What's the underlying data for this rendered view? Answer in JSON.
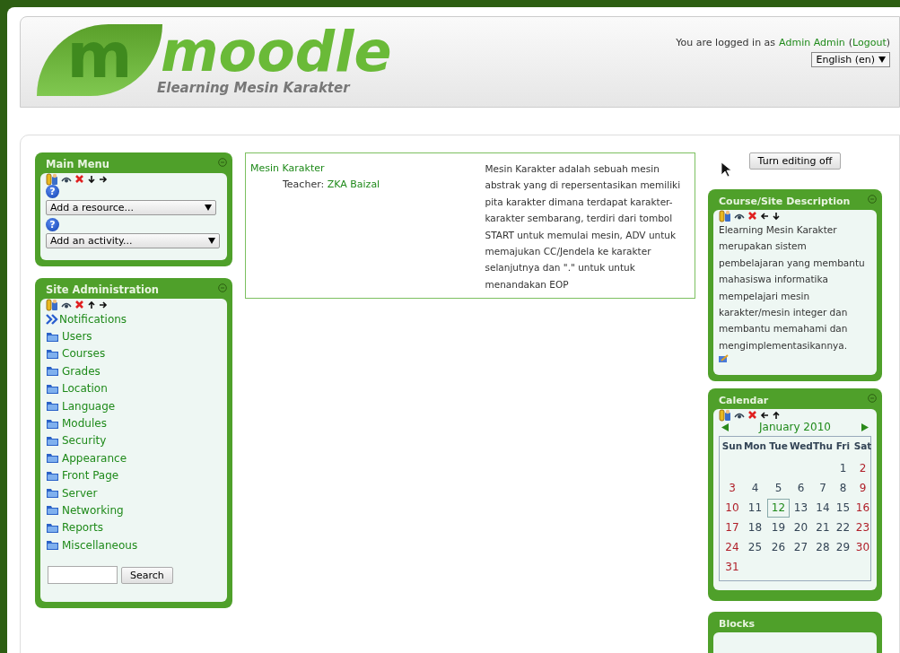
{
  "header": {
    "logo_letter": "m",
    "logo_word": "moodle",
    "site_name": "Elearning Mesin Karakter",
    "login_prefix": "You are logged in as",
    "user": "Admin Admin",
    "paren_open": "(",
    "logout": "Logout",
    "paren_close": ")",
    "language": "English (en)"
  },
  "left_blocks": [
    {
      "kind": "menu",
      "title": "Main Menu",
      "help": "?",
      "selects": [
        "Add a resource...",
        "Add an activity..."
      ]
    },
    {
      "kind": "admin",
      "title": "Site Administration",
      "items": [
        {
          "kind": "link",
          "label": "Notifications"
        },
        {
          "kind": "folder",
          "label": "Users"
        },
        {
          "kind": "folder",
          "label": "Courses"
        },
        {
          "kind": "folder",
          "label": "Grades"
        },
        {
          "kind": "folder",
          "label": "Location"
        },
        {
          "kind": "folder",
          "label": "Language"
        },
        {
          "kind": "folder",
          "label": "Modules"
        },
        {
          "kind": "folder",
          "label": "Security"
        },
        {
          "kind": "folder",
          "label": "Appearance"
        },
        {
          "kind": "folder",
          "label": "Front Page"
        },
        {
          "kind": "folder",
          "label": "Server"
        },
        {
          "kind": "folder",
          "label": "Networking"
        },
        {
          "kind": "folder",
          "label": "Reports"
        },
        {
          "kind": "folder",
          "label": "Miscellaneous"
        }
      ],
      "search_button": "Search"
    }
  ],
  "course": {
    "name": "Mesin Karakter",
    "teacher_label": "Teacher:",
    "teacher": "ZKA Baizal",
    "summary": "Mesin Karakter adalah sebuah mesin abstrak yang di repersentasikan memiliki pita karakter dimana terdapat karakter-karakter sembarang, terdiri dari tombol START untuk memulai mesin, ADV untuk memajukan CC/Jendela ke karakter selanjutnya dan \".\" untuk untuk menandakan EOP"
  },
  "editing_button": "Turn editing off",
  "description_block": {
    "title": "Course/Site Description",
    "text": "Elearning Mesin Karakter merupakan sistem pembelajaran yang membantu mahasiswa informatika mempelajari mesin karakter/mesin integer dan membantu memahami dan mengimplementasikannya."
  },
  "calendar": {
    "title": "Calendar",
    "month": "January 2010",
    "weekdays": [
      "Sun",
      "Mon",
      "Tue",
      "Wed",
      "Thu",
      "Fri",
      "Sat"
    ],
    "weeks": [
      [
        {
          "kind": "blank"
        },
        {
          "kind": "blank"
        },
        {
          "kind": "blank"
        },
        {
          "kind": "blank"
        },
        {
          "kind": "blank"
        },
        {
          "kind": "day",
          "label": "1",
          "weekend": false,
          "selected": false
        },
        {
          "kind": "day",
          "label": "2",
          "weekend": true,
          "selected": false
        }
      ],
      [
        {
          "kind": "day",
          "label": "3",
          "weekend": true,
          "selected": false
        },
        {
          "kind": "day",
          "label": "4",
          "weekend": false,
          "selected": false
        },
        {
          "kind": "day",
          "label": "5",
          "weekend": false,
          "selected": false
        },
        {
          "kind": "day",
          "label": "6",
          "weekend": false,
          "selected": false
        },
        {
          "kind": "day",
          "label": "7",
          "weekend": false,
          "selected": false
        },
        {
          "kind": "day",
          "label": "8",
          "weekend": false,
          "selected": false
        },
        {
          "kind": "day",
          "label": "9",
          "weekend": true,
          "selected": false
        }
      ],
      [
        {
          "kind": "day",
          "label": "10",
          "weekend": true,
          "selected": false
        },
        {
          "kind": "day",
          "label": "11",
          "weekend": false,
          "selected": false
        },
        {
          "kind": "day",
          "label": "12",
          "weekend": false,
          "selected": true
        },
        {
          "kind": "day",
          "label": "13",
          "weekend": false,
          "selected": false
        },
        {
          "kind": "day",
          "label": "14",
          "weekend": false,
          "selected": false
        },
        {
          "kind": "day",
          "label": "15",
          "weekend": false,
          "selected": false
        },
        {
          "kind": "day",
          "label": "16",
          "weekend": true,
          "selected": false
        }
      ],
      [
        {
          "kind": "day",
          "label": "17",
          "weekend": true,
          "selected": false
        },
        {
          "kind": "day",
          "label": "18",
          "weekend": false,
          "selected": false
        },
        {
          "kind": "day",
          "label": "19",
          "weekend": false,
          "selected": false
        },
        {
          "kind": "day",
          "label": "20",
          "weekend": false,
          "selected": false
        },
        {
          "kind": "day",
          "label": "21",
          "weekend": false,
          "selected": false
        },
        {
          "kind": "day",
          "label": "22",
          "weekend": false,
          "selected": false
        },
        {
          "kind": "day",
          "label": "23",
          "weekend": true,
          "selected": false
        }
      ],
      [
        {
          "kind": "day",
          "label": "24",
          "weekend": true,
          "selected": false
        },
        {
          "kind": "day",
          "label": "25",
          "weekend": false,
          "selected": false
        },
        {
          "kind": "day",
          "label": "26",
          "weekend": false,
          "selected": false
        },
        {
          "kind": "day",
          "label": "27",
          "weekend": false,
          "selected": false
        },
        {
          "kind": "day",
          "label": "28",
          "weekend": false,
          "selected": false
        },
        {
          "kind": "day",
          "label": "29",
          "weekend": false,
          "selected": false
        },
        {
          "kind": "day",
          "label": "30",
          "weekend": true,
          "selected": false
        }
      ],
      [
        {
          "kind": "day",
          "label": "31",
          "weekend": true,
          "selected": false
        },
        {
          "kind": "blank"
        },
        {
          "kind": "blank"
        },
        {
          "kind": "blank"
        },
        {
          "kind": "blank"
        },
        {
          "kind": "blank"
        },
        {
          "kind": "blank"
        }
      ]
    ]
  },
  "blocks_block": {
    "title": "Blocks"
  }
}
